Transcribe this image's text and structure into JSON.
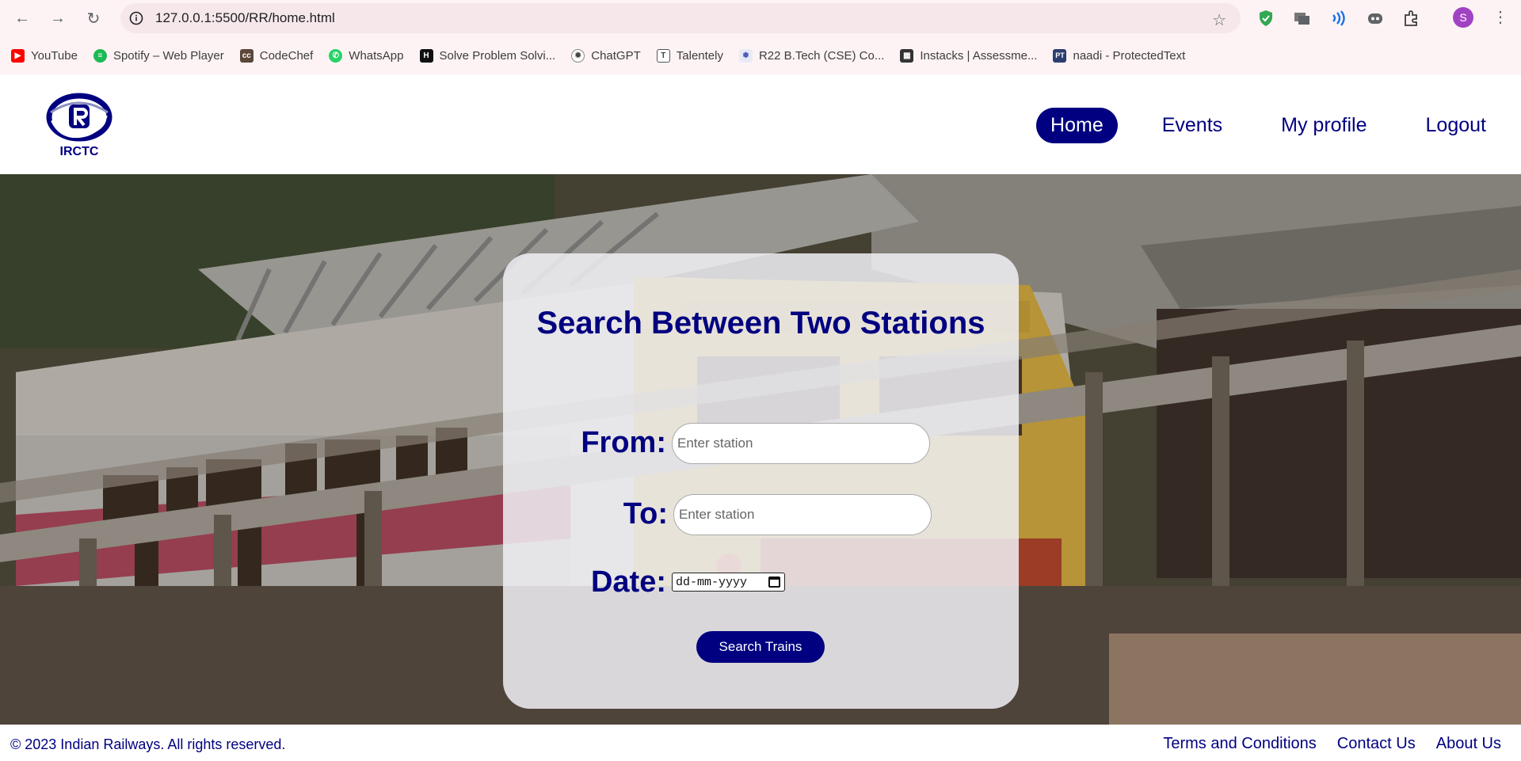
{
  "browser": {
    "url": "127.0.0.1:5500/RR/home.html",
    "profile_initial": "S",
    "bookmarks": [
      {
        "label": "YouTube",
        "icon": "youtube-icon",
        "color": "#ff0000"
      },
      {
        "label": "Spotify – Web Player",
        "icon": "spotify-icon",
        "color": "#1db954"
      },
      {
        "label": "CodeChef",
        "icon": "codechef-icon",
        "color": "#5b4638"
      },
      {
        "label": "WhatsApp",
        "icon": "whatsapp-icon",
        "color": "#25d366"
      },
      {
        "label": "Solve Problem Solvi...",
        "icon": "hackerrank-icon",
        "color": "#111111"
      },
      {
        "label": "ChatGPT",
        "icon": "chatgpt-icon",
        "color": "#444444"
      },
      {
        "label": "Talentely",
        "icon": "talentely-icon",
        "color": "#555555"
      },
      {
        "label": "R22 B.Tech (CSE) Co...",
        "icon": "college-icon",
        "color": "#3f51b5"
      },
      {
        "label": "Instacks | Assessme...",
        "icon": "instacks-icon",
        "color": "#333333"
      },
      {
        "label": "naadi - ProtectedText",
        "icon": "protectedtext-icon",
        "color": "#2c3e70"
      }
    ]
  },
  "header": {
    "logo_text": "IRCTC",
    "nav": [
      {
        "label": "Home",
        "active": true
      },
      {
        "label": "Events",
        "active": false
      },
      {
        "label": "My profile",
        "active": false
      },
      {
        "label": "Logout",
        "active": false
      }
    ]
  },
  "search": {
    "title": "Search Between Two Stations",
    "from_label": "From:",
    "to_label": "To:",
    "date_label": "Date:",
    "from_placeholder": "Enter station",
    "to_placeholder": "Enter station",
    "date_placeholder": "dd-mm-yyyy",
    "button_label": "Search Trains"
  },
  "footer": {
    "copyright": "© 2023 Indian Railways. All rights reserved.",
    "links": [
      "Terms and Conditions",
      "Contact Us",
      "About Us"
    ]
  },
  "colors": {
    "brand_navy": "#000080",
    "chrome_bg": "#fdf3f4"
  }
}
